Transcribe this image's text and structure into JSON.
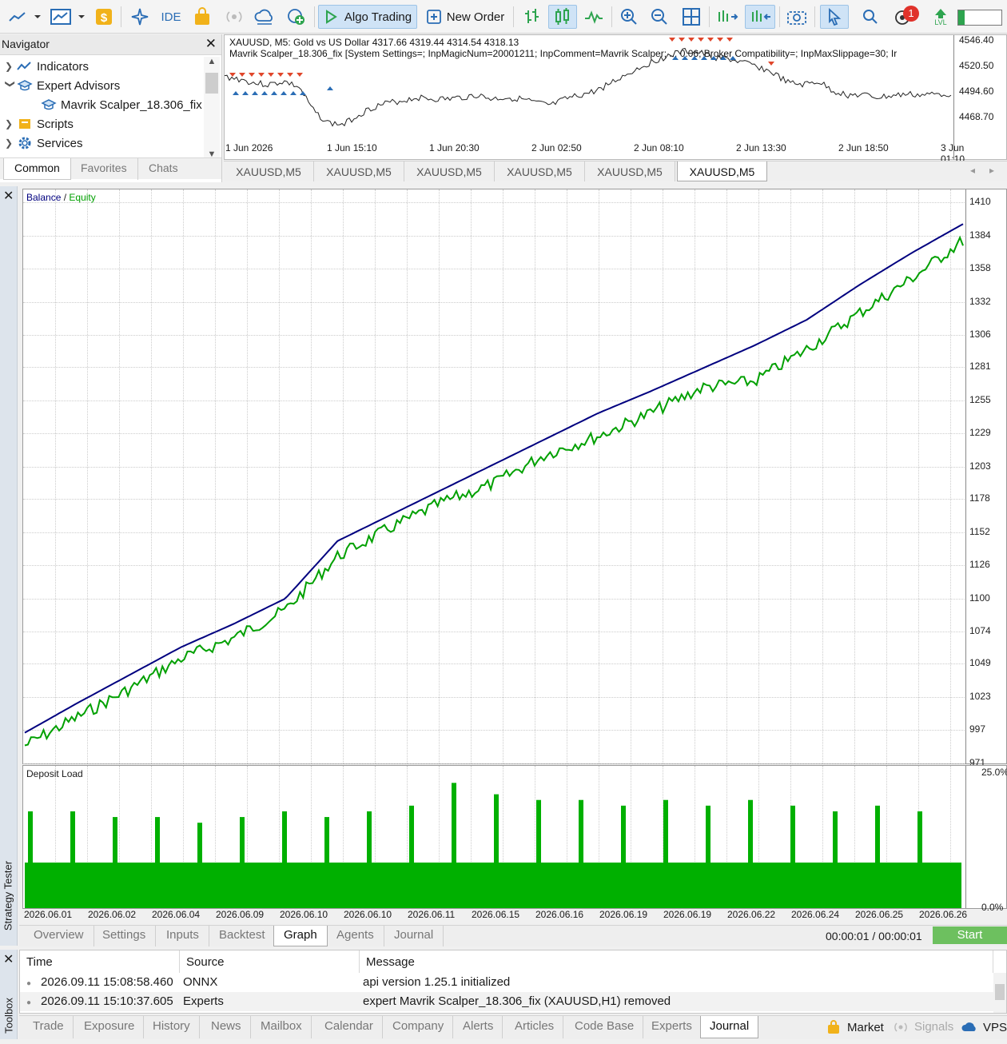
{
  "toolbar": {
    "algo_trading_label": "Algo Trading",
    "new_order_label": "New Order",
    "ide_label": "IDE",
    "notification_count": "1",
    "level_label": "LVL"
  },
  "navigator": {
    "title": "Navigator",
    "items": [
      {
        "label": "Indicators",
        "icon": "indicators-icon"
      },
      {
        "label": "Expert Advisors",
        "icon": "expert-advisors-icon"
      },
      {
        "label": "Mavrik Scalper_18.306_fix",
        "icon": "expert-advisor-hat-icon"
      },
      {
        "label": "Scripts",
        "icon": "scripts-icon"
      },
      {
        "label": "Services",
        "icon": "gear-icon"
      }
    ],
    "tabs": [
      "Common",
      "Favorites",
      "Chats"
    ]
  },
  "price_chart": {
    "line1": "XAUUSD, M5:  Gold vs US Dollar   4317.66 4319.44 4314.54 4318.13",
    "line2": "Mavrik Scalper_18.306_fix [System Settings=; InpMagicNum=20001211; InpComment=Mavrik Scalper; ... 0.06; Broker Compatibility=; InpMaxSlippage=30; Ir",
    "price_labels": [
      "4546.40",
      "4520.50",
      "4494.60",
      "4468.70"
    ],
    "time_labels": [
      "1 Jun 2026",
      "1 Jun 15:10",
      "1 Jun 20:30",
      "2 Jun 02:50",
      "2 Jun 08:10",
      "2 Jun 13:30",
      "2 Jun 18:50",
      "3 Jun 01:10"
    ],
    "tabs": [
      "XAUUSD,M5",
      "XAUUSD,M5",
      "XAUUSD,M5",
      "XAUUSD,M5",
      "XAUUSD,M5",
      "XAUUSD,M5"
    ]
  },
  "tester": {
    "side_label": "Strategy Tester",
    "legend_balance": "Balance",
    "legend_sep": "/",
    "legend_equity": "Equity",
    "deposit_label": "Deposit Load",
    "deposit_top": "25.0%",
    "deposit_bottom": "0.0%",
    "tabs": [
      "Overview",
      "Settings",
      "Inputs",
      "Backtest",
      "Graph",
      "Agents",
      "Journal"
    ],
    "active_tab": "Graph",
    "timer": "00:00:01 / 00:00:01",
    "start_label": "Start",
    "colors": {
      "balance": "#00007f",
      "equity": "#00a000",
      "deposit": "#00b000"
    }
  },
  "chart_data": [
    {
      "type": "line",
      "title": "",
      "series": [
        {
          "name": "Balance",
          "values": [
            995,
            1018,
            1040,
            1062,
            1080,
            1100,
            1145,
            1165,
            1185,
            1205,
            1225,
            1245,
            1262,
            1280,
            1298,
            1318,
            1345,
            1370,
            1393
          ]
        },
        {
          "name": "Equity",
          "values": [
            990,
            1012,
            1034,
            1058,
            1074,
            1096,
            1138,
            1160,
            1180,
            1195,
            1218,
            1232,
            1250,
            1270,
            1275,
            1300,
            1328,
            1355,
            1385
          ]
        }
      ],
      "x": [
        "2026.06.01",
        "2026.06.02",
        "2026.06.04",
        "2026.06.09",
        "2026.06.10",
        "2026.06.10",
        "2026.06.11",
        "2026.06.15",
        "2026.06.16",
        "2026.06.19",
        "2026.06.19",
        "2026.06.22",
        "2026.06.24",
        "2026.06.25",
        "2026.06.26"
      ],
      "y_ticks": [
        "1410",
        "1384",
        "1358",
        "1332",
        "1306",
        "1281",
        "1255",
        "1229",
        "1203",
        "1178",
        "1152",
        "1126",
        "1100",
        "1074",
        "1049",
        "1023",
        "997",
        "971"
      ],
      "ylim": [
        971,
        1420
      ],
      "grid": true,
      "legend": "top-left"
    },
    {
      "type": "bar",
      "title": "Deposit Load",
      "ylim": [
        0,
        25
      ],
      "y_ticks": [
        "25.0%",
        "0.0%"
      ],
      "x_ticks": [
        "2026.06.01",
        "2026.06.02",
        "2026.06.04",
        "2026.06.09",
        "2026.06.10",
        "2026.06.10",
        "2026.06.11",
        "2026.06.15",
        "2026.06.16",
        "2026.06.19",
        "2026.06.19",
        "2026.06.22",
        "2026.06.24",
        "2026.06.25",
        "2026.06.26"
      ],
      "baseline_load": 8,
      "spikes": [
        17,
        17,
        16,
        16,
        15,
        16,
        17,
        16,
        17,
        18,
        22,
        20,
        19,
        19,
        18,
        19,
        18,
        19,
        18,
        17,
        18,
        17
      ]
    }
  ],
  "journal": {
    "headers": [
      "Time",
      "Source",
      "Message"
    ],
    "rows": [
      {
        "time": "2026.09.11 15:08:58.460",
        "source": "ONNX",
        "message": "api version 1.25.1 initialized"
      },
      {
        "time": "2026.09.11 15:10:37.605",
        "source": "Experts",
        "message": "expert Mavrik Scalper_18.306_fix (XAUUSD,H1) removed"
      }
    ]
  },
  "toolbox": {
    "side_label": "Toolbox",
    "tabs": [
      "Trade",
      "Exposure",
      "History",
      "News",
      "Mailbox",
      "Calendar",
      "Company",
      "Alerts",
      "Articles",
      "Code Base",
      "Experts",
      "Journal"
    ],
    "active_tab": "Journal",
    "market_label": "Market",
    "signals_label": "Signals",
    "vps_label": "VPS"
  }
}
